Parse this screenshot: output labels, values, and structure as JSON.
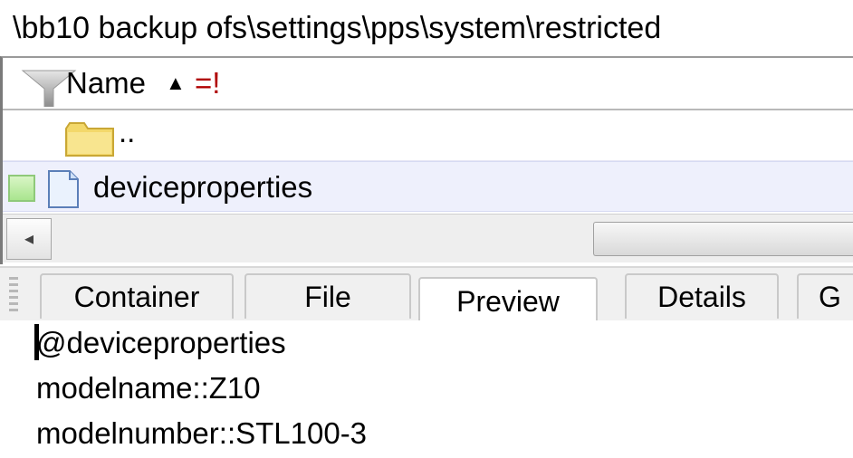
{
  "path": {
    "text": "\\bb10 backup ofs\\settings\\pps\\system\\restricted"
  },
  "list": {
    "column_name": "Name",
    "sort_glyph": "▲",
    "sort_extra": "=!",
    "parent_row": {
      "label": ".."
    },
    "file_row": {
      "label": "deviceproperties"
    }
  },
  "scrollbar": {
    "left_arrow": "◂"
  },
  "tabs": [
    {
      "label": "Container"
    },
    {
      "label": "File"
    },
    {
      "label": "Preview"
    },
    {
      "label": "Details"
    },
    {
      "label": "G"
    }
  ],
  "active_tab": "Preview",
  "preview": {
    "lines": [
      "@deviceproperties",
      "modelname::Z10",
      "modelnumber::STL100-3"
    ]
  },
  "icons": {
    "filter": "filter-icon",
    "folder": "folder-icon",
    "document": "document-icon"
  }
}
